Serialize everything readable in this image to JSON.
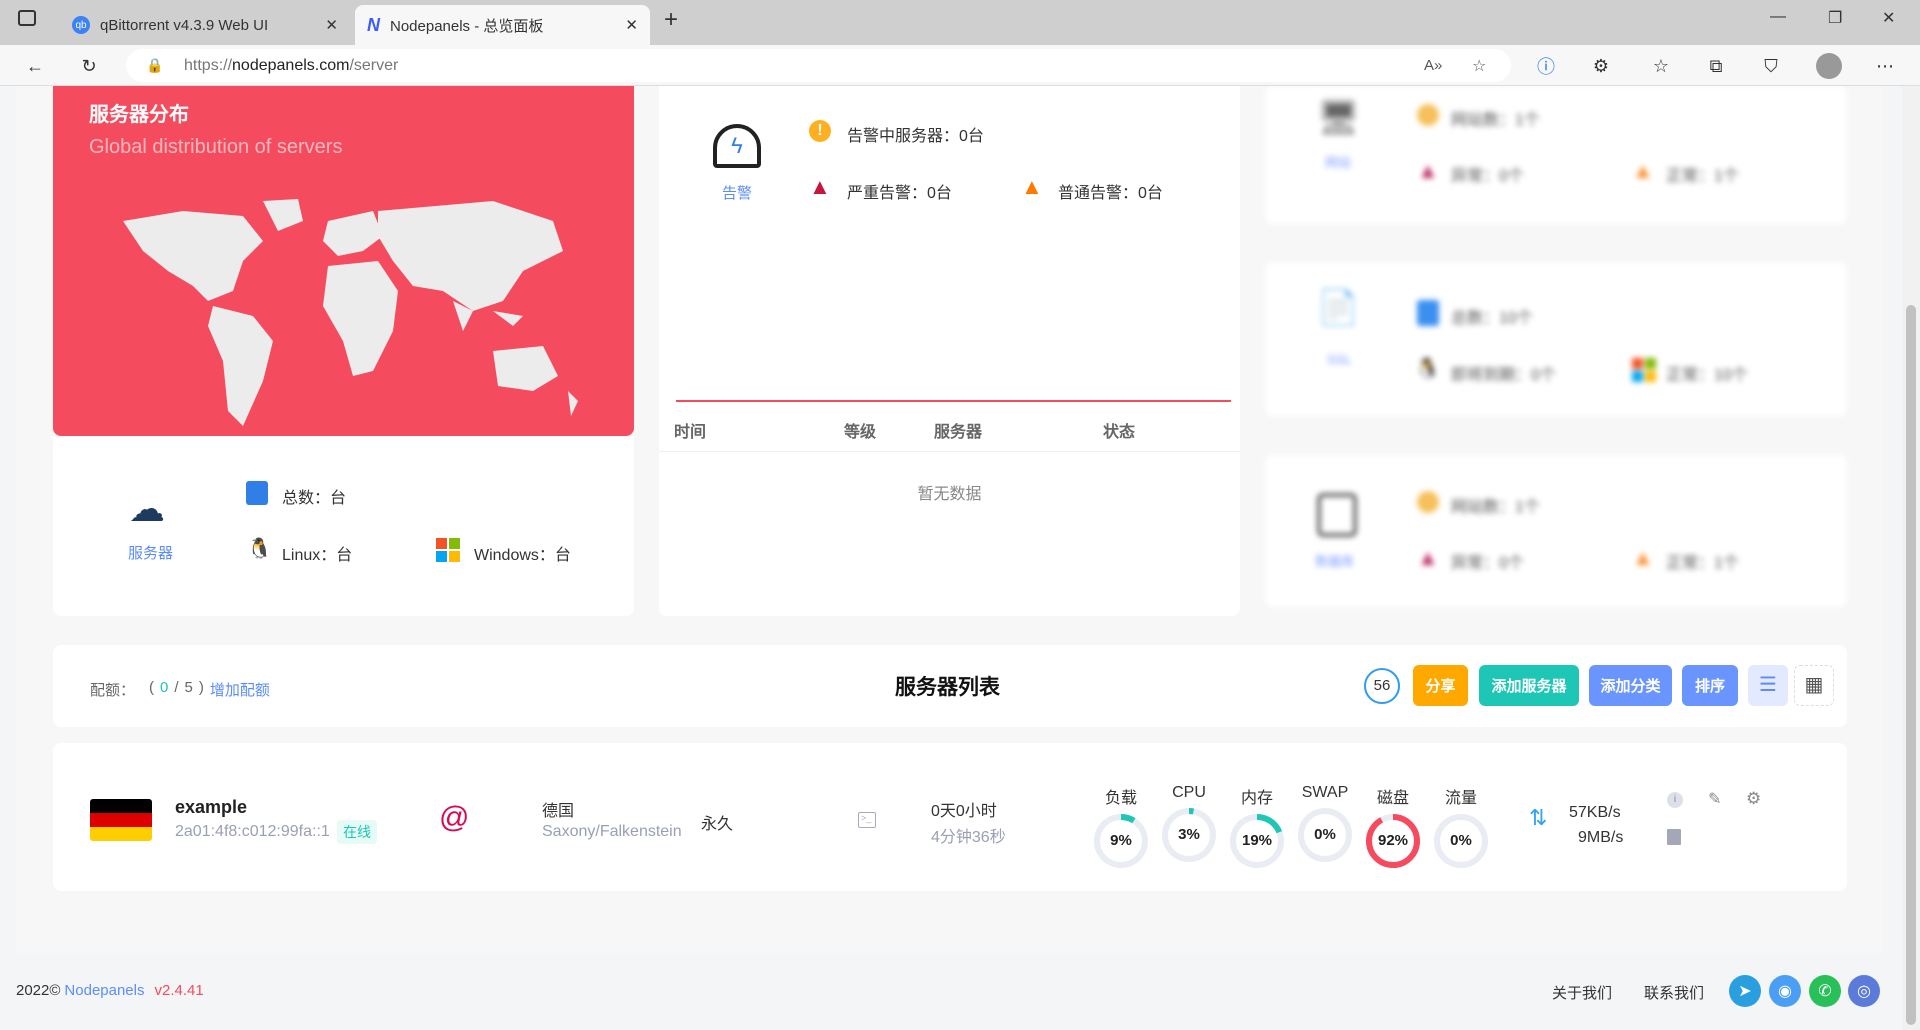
{
  "browser": {
    "tabs": [
      {
        "title": "qBittorrent v4.3.9 Web UI",
        "icon": "qb"
      },
      {
        "title": "Nodepanels - 总览面板",
        "icon": "N"
      }
    ],
    "url_prefix": "https://",
    "url_host": "nodepanels.com",
    "url_path": "/server"
  },
  "map_card": {
    "title": "服务器分布",
    "subtitle": "Global distribution of servers"
  },
  "server_summary": {
    "label": "服务器",
    "total": "总数：台",
    "linux": "Linux：台",
    "windows": "Windows：台"
  },
  "alerts": {
    "label": "告警",
    "in_alarm": "告警中服务器：0台",
    "severe": "严重告警：0台",
    "normal": "普通告警：0台",
    "columns": [
      "时间",
      "等级",
      "服务器",
      "状态"
    ],
    "empty": "暂无数据"
  },
  "site_card": {
    "label": "网站",
    "count": "网站数：1个",
    "abnormal": "异常：0个",
    "ok": "正常：1个"
  },
  "ssl_card": {
    "label": "SSL",
    "total": "总数：10个",
    "expiring": "即将到期：0个",
    "ok": "正常：10个"
  },
  "db_card": {
    "label": "数据库",
    "count": "网站数：1个",
    "abnormal": "异常：0个",
    "ok": "正常：1个"
  },
  "list": {
    "quota_label": "配额：",
    "quota_open": "(",
    "quota_used": "0",
    "quota_sep": "/",
    "quota_total": "5",
    "quota_close": ")",
    "add_quota": "增加配额",
    "title": "服务器列表",
    "countdown": "56",
    "share": "分享",
    "add_server": "添加服务器",
    "add_category": "添加分类",
    "sort": "排序"
  },
  "server": {
    "name": "example",
    "ip": "2a01:4f8:c012:99fa::1",
    "status": "在线",
    "country": "德国",
    "region": "Saxony/Falkenstein",
    "expiry": "永久",
    "uptime": "0天0小时",
    "uptime_detail": "4分钟36秒",
    "up_speed": "57KB/s",
    "down_speed": "9MB/s",
    "gauges": [
      {
        "label": "负载",
        "value": 9,
        "text": "9%",
        "color": "#1ec6b6"
      },
      {
        "label": "CPU",
        "value": 3,
        "text": "3%",
        "color": "#1ec6b6"
      },
      {
        "label": "内存",
        "value": 19,
        "text": "19%",
        "color": "#1ec6b6"
      },
      {
        "label": "SWAP",
        "value": 0,
        "text": "0%",
        "color": "#1ec6b6"
      },
      {
        "label": "磁盘",
        "value": 92,
        "text": "92%",
        "color": "#f54b5e"
      },
      {
        "label": "流量",
        "value": 0,
        "text": "0%",
        "color": "#1ec6b6"
      }
    ]
  },
  "footer": {
    "year": "2022©",
    "brand": "Nodepanels",
    "version": "v2.4.41",
    "about": "关于我们",
    "contact": "联系我们"
  },
  "colors": {
    "accent": "#5b8cff",
    "red": "#f54b5e",
    "teal": "#1ec6b6",
    "orange": "#ffa800"
  }
}
